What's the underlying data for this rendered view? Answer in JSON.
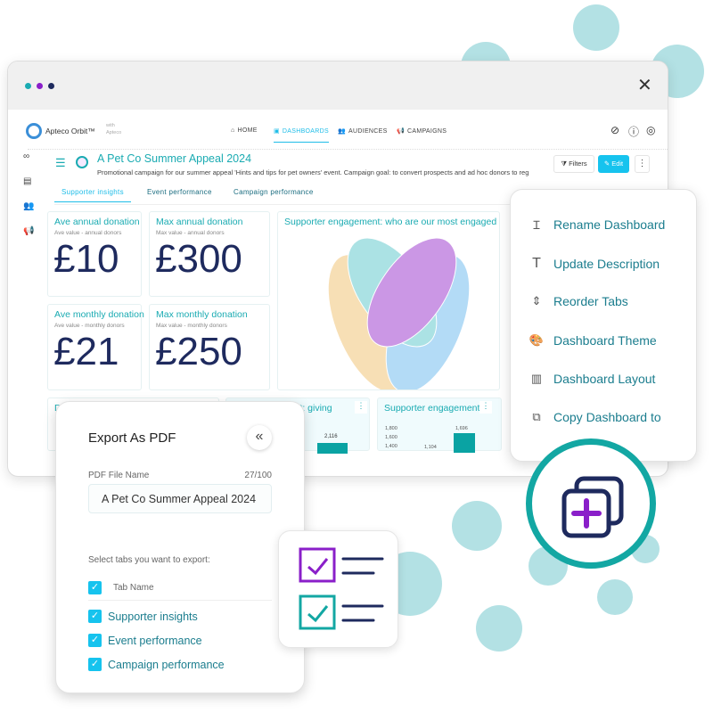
{
  "window": {
    "close_icon": "close-icon"
  },
  "app": {
    "brand": "Apteco Orbit™",
    "with": "with",
    "with_brand": "Apteco",
    "nav": [
      {
        "label": "HOME",
        "icon": "home-icon"
      },
      {
        "label": "DASHBOARDS",
        "icon": "dashboard-icon",
        "active": true
      },
      {
        "label": "AUDIENCES",
        "icon": "people-icon"
      },
      {
        "label": "CAMPAIGNS",
        "icon": "megaphone-icon"
      }
    ]
  },
  "dashboard": {
    "title": "A Pet Co Summer Appeal 2024",
    "description": "Promotional campaign for our summer appeal 'Hints and tips for pet owners' event. Campaign goal: to convert prospects and ad hoc donors to reg",
    "filters_label": "Filters",
    "edit_label": "Edit",
    "tabs": [
      {
        "label": "Supporter insights",
        "active": true
      },
      {
        "label": "Event performance"
      },
      {
        "label": "Campaign performance"
      }
    ]
  },
  "kpis": [
    {
      "title": "Ave annual donation",
      "subtitle": "Ave value - annual donors",
      "value": "£10"
    },
    {
      "title": "Max annual donation",
      "subtitle": "Max value - annual donors",
      "value": "£300"
    },
    {
      "title": "Ave monthly donation",
      "subtitle": "Ave value - monthly donors",
      "value": "£21"
    },
    {
      "title": "Max monthly donation",
      "subtitle": "Max value - monthly donors",
      "value": "£250"
    }
  ],
  "venn": {
    "title": "Supporter engagement: who are our most engaged su",
    "colors": [
      "#7fd3d6",
      "#b061d8",
      "#f4cf8f",
      "#8cc8f2"
    ]
  },
  "bottom_cards": [
    {
      "title": "D"
    },
    {
      "title": "ment: giving",
      "bar_label": "2,116"
    },
    {
      "title": "Supporter engagement:",
      "ticks": [
        "1,800",
        "1,600",
        "1,400"
      ],
      "bar_labels": [
        "1,104",
        "1,696"
      ]
    }
  ],
  "menu": {
    "items": [
      {
        "label": "Rename Dashboard",
        "icon": "text-cursor-icon"
      },
      {
        "label": "Update Description",
        "icon": "text-icon"
      },
      {
        "label": "Reorder Tabs",
        "icon": "reorder-icon"
      },
      {
        "label": "Dashboard Theme",
        "icon": "palette-icon"
      },
      {
        "label": "Dashboard Layout",
        "icon": "layout-icon"
      },
      {
        "label": "Copy Dashboard to",
        "icon": "copy-to-icon"
      }
    ]
  },
  "export": {
    "title": "Export As PDF",
    "file_label": "PDF File Name",
    "count": "27/100",
    "file_value": "A Pet Co Summer Appeal 2024",
    "select_label": "Select tabs you want to export:",
    "header": "Tab Name",
    "tabs": [
      "Supporter insights",
      "Event performance",
      "Campaign performance"
    ]
  },
  "colors": {
    "accent": "#1aabb2",
    "bubble": "#b3e1e4",
    "navy": "#1e2a5e",
    "purple": "#8a1fc9",
    "button": "#16c3ee"
  }
}
